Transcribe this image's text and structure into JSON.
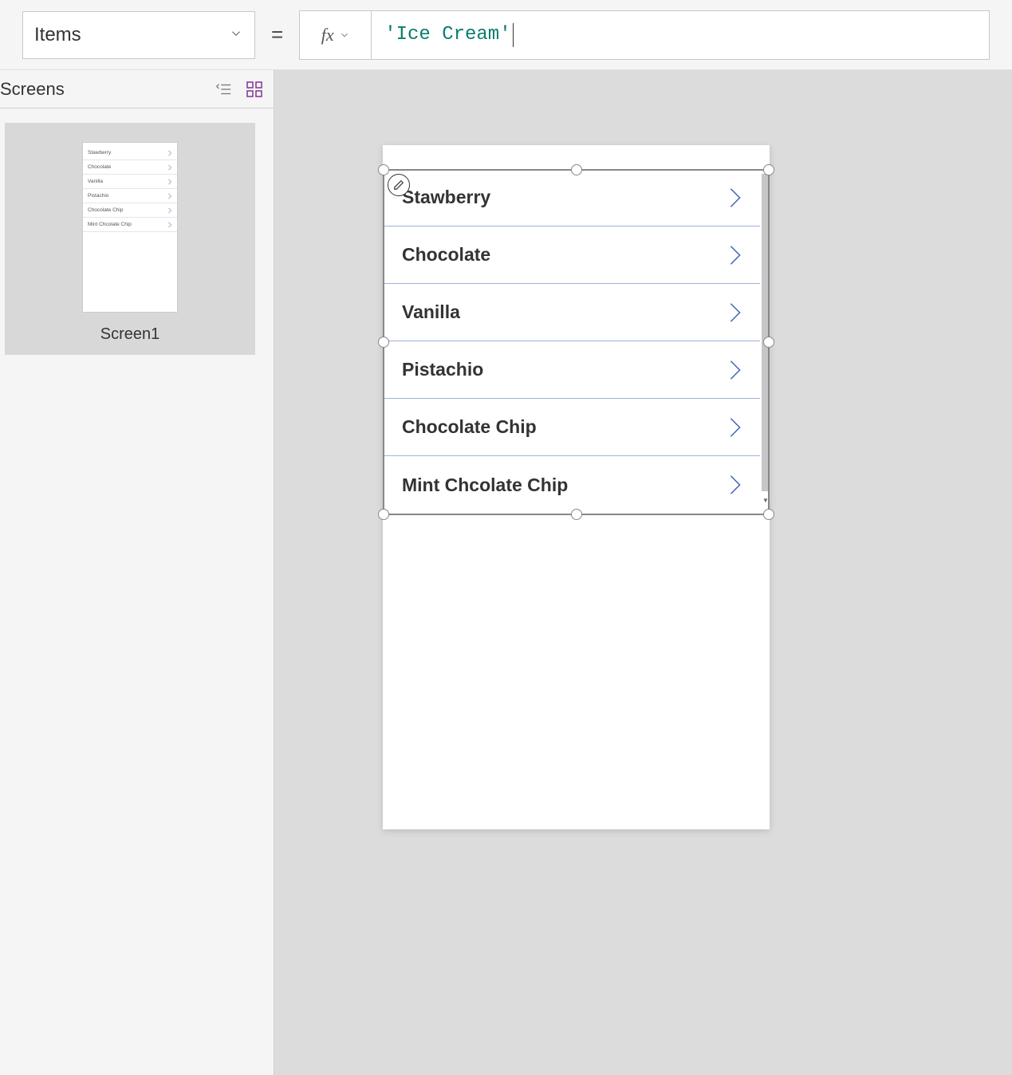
{
  "formula_bar": {
    "property": "Items",
    "equals": "=",
    "formula": "'Ice Cream'"
  },
  "left_panel": {
    "title": "Screens",
    "screen_name": "Screen1"
  },
  "gallery": {
    "items": [
      "Stawberry",
      "Chocolate",
      "Vanilla",
      "Pistachio",
      "Chocolate Chip",
      "Mint Chcolate Chip"
    ]
  }
}
